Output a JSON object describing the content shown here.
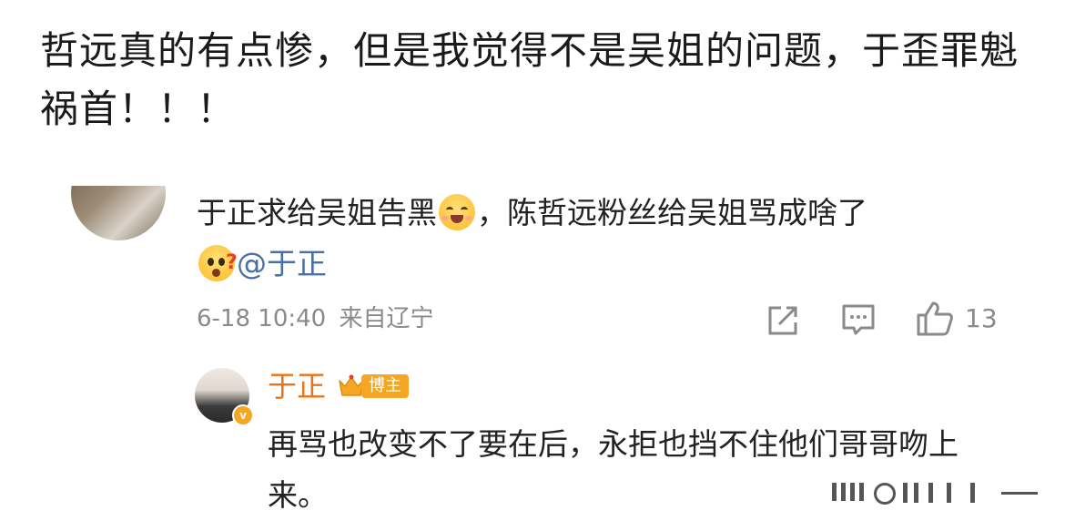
{
  "post": {
    "text": "哲远真的有点惨，但是我觉得不是吴姐的问题，于歪罪魁祸首！！！"
  },
  "comment": {
    "text_part1": "于正求给吴姐告黑",
    "text_part2": "，陈哲远粉丝给吴姐骂成啥了",
    "mention": "@于正",
    "emojis": [
      "laughing-face",
      "confused-face"
    ],
    "date": "6-18 10:40",
    "location": "来自辽宁",
    "like_count": "13"
  },
  "reply": {
    "author": "于正",
    "badge": "博主",
    "verified_mark": "v",
    "text": "再骂也改变不了要在后，永拒也挡不住他们哥哥吻上来。"
  },
  "colors": {
    "author": "#eb7316",
    "mention": "#4a6fa5",
    "badge": "#f5a623",
    "meta": "#8a8a8a"
  }
}
